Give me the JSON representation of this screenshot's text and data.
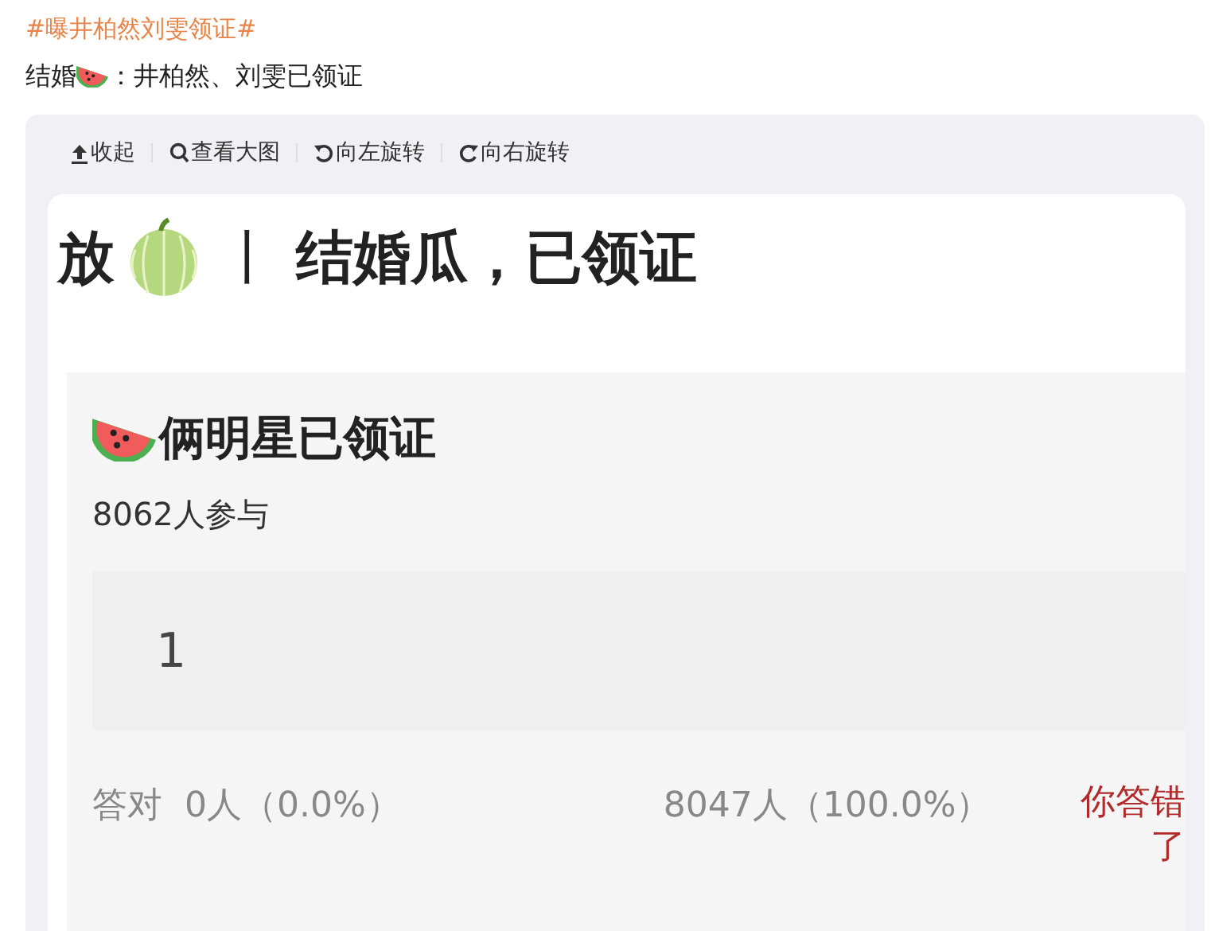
{
  "post": {
    "hashtag": "#曝井柏然刘雯领证#",
    "text_before": "结婚",
    "text_after": "：井柏然、刘雯已领证"
  },
  "image_toolbar": [
    {
      "kind": "collapse",
      "label": "收起"
    },
    {
      "kind": "zoom",
      "label": "查看大图"
    },
    {
      "kind": "rotate_left",
      "label": "向左旋转"
    },
    {
      "kind": "rotate_right",
      "label": "向右旋转"
    }
  ],
  "image": {
    "title_prefix": "放",
    "separator": "丨",
    "title": "结婚瓜，已领证",
    "quiz": {
      "title": "俩明星已领证",
      "participants": "8062人参与",
      "option": "1",
      "correct_label": "答对",
      "correct_count": "0人（0.0%）",
      "other_count": "8047人（100.0%）",
      "verdict": "你答错了"
    }
  }
}
